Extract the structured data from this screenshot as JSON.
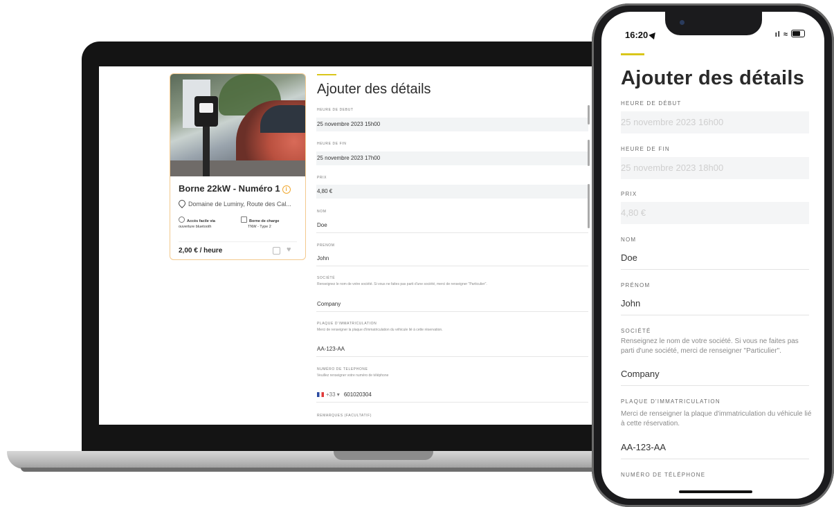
{
  "laptop": {
    "card": {
      "title": "Borne 22kW - Numéro 1",
      "info_symbol": "i",
      "location": "Domaine de Luminy, Route des Cal...",
      "features": [
        {
          "title": "Accès facile via",
          "subtitle": "ouverture bluetooth"
        },
        {
          "title": "Borne de charge",
          "subtitle": "TNW - Type 2"
        }
      ],
      "price": "2,00 € / heure"
    },
    "form": {
      "title": "Ajouter des détails",
      "fields": {
        "start": {
          "label": "HEURE DE DEBUT",
          "value": "25 novembre 2023 15h00"
        },
        "end": {
          "label": "HEURE DE FIN",
          "value": "25 novembre 2023 17h00"
        },
        "price": {
          "label": "PRIX",
          "value": "4,80 €"
        },
        "lastname": {
          "label": "NOM",
          "value": "Doe"
        },
        "firstname": {
          "label": "PRENOM",
          "value": "John"
        },
        "company": {
          "label": "SOCIÉTÉ",
          "help": "Renseignez le nom de votre société. Si vous ne faites pas parti d'une société, merci de renseigner \"Particulier\".",
          "value": "Company"
        },
        "plate": {
          "label": "PLAQUE D'IMMATRICULATION",
          "help": "Merci de renseigner la plaque d'immatriculation du véhicule lié à cette réservation.",
          "value": "AA-123-AA"
        },
        "phone": {
          "label": "NUMÉRO DE TELEPHONE",
          "help": "Veuillez renseigner votre numéro de téléphone",
          "prefix": "+33 ▾",
          "value": "601020304"
        },
        "remarks": {
          "label": "REMARQUES (FACULTATIF)"
        }
      }
    }
  },
  "phone": {
    "status": {
      "time": "16:20",
      "signal": "ıl ≈"
    },
    "form": {
      "title": "Ajouter des détails",
      "fields": {
        "start": {
          "label": "HEURE DE DÉBUT",
          "value": "25 novembre 2023 16h00"
        },
        "end": {
          "label": "HEURE DE FIN",
          "value": "25 novembre 2023 18h00"
        },
        "price": {
          "label": "PRIX",
          "value": "4,80 €"
        },
        "lastname": {
          "label": "NOM",
          "value": "Doe"
        },
        "firstname": {
          "label": "PRÉNOM",
          "value": "John"
        },
        "company": {
          "label": "SOCIÉTÉ",
          "help": "Renseignez le nom de votre société. Si vous ne faites pas parti d'une société, merci de renseigner \"Particulier\".",
          "value": "Company"
        },
        "plate": {
          "label": "PLAQUE D'IMMATRICULATION",
          "help": "Merci de renseigner la plaque d'immatriculation du véhicule lié à cette réservation.",
          "value": "AA-123-AA"
        },
        "phone": {
          "label": "NUMÉRO DE TÉLÉPHONE"
        }
      }
    }
  },
  "colors": {
    "accent": "#d9c61a",
    "card_border": "#f3c98d",
    "info_icon": "#f0a830"
  }
}
